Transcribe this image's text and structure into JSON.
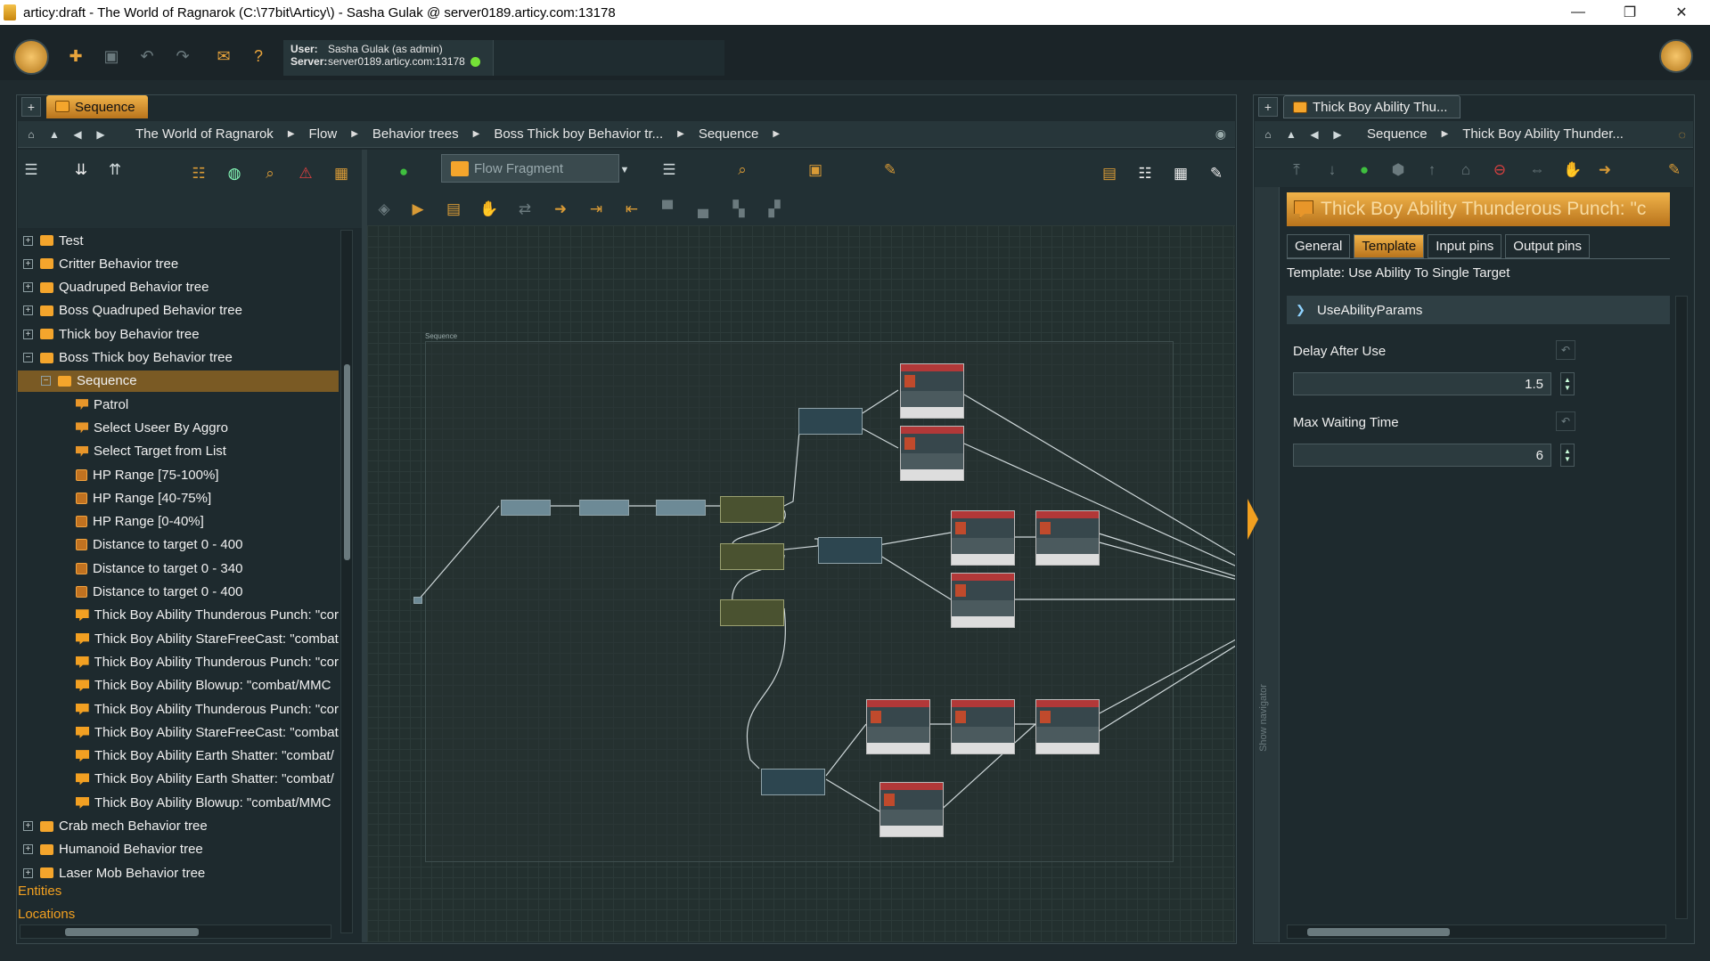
{
  "window": {
    "title": "articy:draft - The World of Ragnarok (C:\\77bit\\Articy\\) - Sasha Gulak @ server0189.articy.com:13178",
    "minimize_glyph": "—",
    "restore_glyph": "❐",
    "close_glyph": "✕"
  },
  "session": {
    "user_label": "User:",
    "user_value": "Sasha Gulak (as admin)",
    "server_label": "Server:",
    "server_value": "server0189.articy.com:13178",
    "status_color": "#74e237"
  },
  "left_panel": {
    "tab_label": "Sequence",
    "plus": "+",
    "breadcrumbs": [
      "The World of Ragnarok",
      "Flow",
      "Behavior trees",
      "Boss Thick boy Behavior tr...",
      "Sequence"
    ],
    "flow_fragment_label": "Flow Fragment",
    "tree": [
      {
        "label": "Test",
        "level": 0,
        "expander": "+",
        "icon": "folder"
      },
      {
        "label": "Critter Behavior tree",
        "level": 0,
        "expander": "+",
        "icon": "folder"
      },
      {
        "label": "Quadruped Behavior tree",
        "level": 0,
        "expander": "+",
        "icon": "folder"
      },
      {
        "label": "Boss Quadruped Behavior tree",
        "level": 0,
        "expander": "+",
        "icon": "folder"
      },
      {
        "label": "Thick boy Behavior tree",
        "level": 0,
        "expander": "+",
        "icon": "folder"
      },
      {
        "label": "Boss Thick boy Behavior tree",
        "level": 0,
        "expander": "−",
        "icon": "folder"
      },
      {
        "label": "Sequence",
        "level": 1,
        "expander": "−",
        "icon": "folder",
        "selected": true
      },
      {
        "label": "Patrol",
        "level": 2,
        "expander": "",
        "icon": "script"
      },
      {
        "label": "Select Useer By Aggro",
        "level": 2,
        "expander": "",
        "icon": "script"
      },
      {
        "label": "Select Target from List",
        "level": 2,
        "expander": "",
        "icon": "script"
      },
      {
        "label": "HP Range [75-100%]",
        "level": 2,
        "expander": "",
        "icon": "condition"
      },
      {
        "label": "HP Range [40-75%]",
        "level": 2,
        "expander": "",
        "icon": "condition"
      },
      {
        "label": "HP Range [0-40%]",
        "level": 2,
        "expander": "",
        "icon": "condition"
      },
      {
        "label": "Distance to target 0 - 400",
        "level": 2,
        "expander": "",
        "icon": "condition"
      },
      {
        "label": "Distance to target 0 - 340",
        "level": 2,
        "expander": "",
        "icon": "condition"
      },
      {
        "label": "Distance to target 0 - 400",
        "level": 2,
        "expander": "",
        "icon": "condition"
      },
      {
        "label": "Thick Boy Ability Thunderous Punch: \"cor",
        "level": 2,
        "expander": "",
        "icon": "dialogue"
      },
      {
        "label": "Thick Boy Ability StareFreeCast: \"combat",
        "level": 2,
        "expander": "",
        "icon": "dialogue"
      },
      {
        "label": "Thick Boy Ability Thunderous Punch: \"cor",
        "level": 2,
        "expander": "",
        "icon": "dialogue"
      },
      {
        "label": "Thick Boy Ability Blowup: \"combat/MMC",
        "level": 2,
        "expander": "",
        "icon": "dialogue"
      },
      {
        "label": "Thick Boy Ability Thunderous Punch: \"cor",
        "level": 2,
        "expander": "",
        "icon": "dialogue"
      },
      {
        "label": "Thick Boy Ability StareFreeCast: \"combat",
        "level": 2,
        "expander": "",
        "icon": "dialogue"
      },
      {
        "label": "Thick Boy Ability Earth Shatter: \"combat/",
        "level": 2,
        "expander": "",
        "icon": "dialogue"
      },
      {
        "label": "Thick Boy Ability Earth Shatter: \"combat/",
        "level": 2,
        "expander": "",
        "icon": "dialogue"
      },
      {
        "label": "Thick Boy Ability Blowup: \"combat/MMC",
        "level": 2,
        "expander": "",
        "icon": "dialogue"
      },
      {
        "label": "Crab mech Behavior tree",
        "level": 0,
        "expander": "+",
        "icon": "folder"
      },
      {
        "label": "Humanoid Behavior tree",
        "level": 0,
        "expander": "+",
        "icon": "folder"
      },
      {
        "label": "Laser Mob Behavior tree",
        "level": 0,
        "expander": "+",
        "icon": "folder"
      }
    ],
    "categories": [
      "Entities",
      "Locations"
    ]
  },
  "canvas": {
    "frame_label": "Sequence"
  },
  "right_panel": {
    "tab_label": "Thick Boy Ability Thu...",
    "plus": "+",
    "breadcrumbs": [
      "Sequence",
      "Thick Boy Ability Thunder..."
    ],
    "header_title": "Thick Boy Ability Thunderous Punch: \"c",
    "tabs": [
      "General",
      "Template",
      "Input pins",
      "Output pins"
    ],
    "active_tab": "Template",
    "template_line": "Template: Use Ability To Single Target",
    "section_title": "UseAbilityParams",
    "fields": [
      {
        "label": "Delay After Use",
        "value": "1.5"
      },
      {
        "label": "Max Waiting Time",
        "value": "6"
      }
    ],
    "show_navigator": "Show navigator"
  }
}
